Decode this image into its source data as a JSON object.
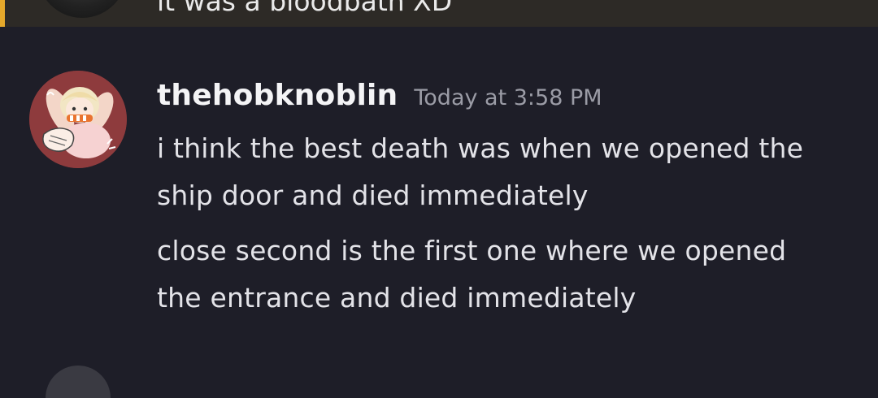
{
  "previous_message": {
    "text": "it was a bloodbath XD"
  },
  "message": {
    "username": "thehobknoblin",
    "timestamp": "Today at 3:58 PM",
    "lines": [
      "i think the best death was when we opened the",
      "ship door and died immediately",
      "close second is the first one where we opened",
      "the entrance and died immediately"
    ]
  },
  "colors": {
    "background": "#1e1e28",
    "highlight_background": "#2d2a26",
    "mention_accent": "#e5a82b",
    "avatar_background": "#8e3b3d",
    "username": "#f4f4f6",
    "timestamp": "#9b9ca6"
  }
}
